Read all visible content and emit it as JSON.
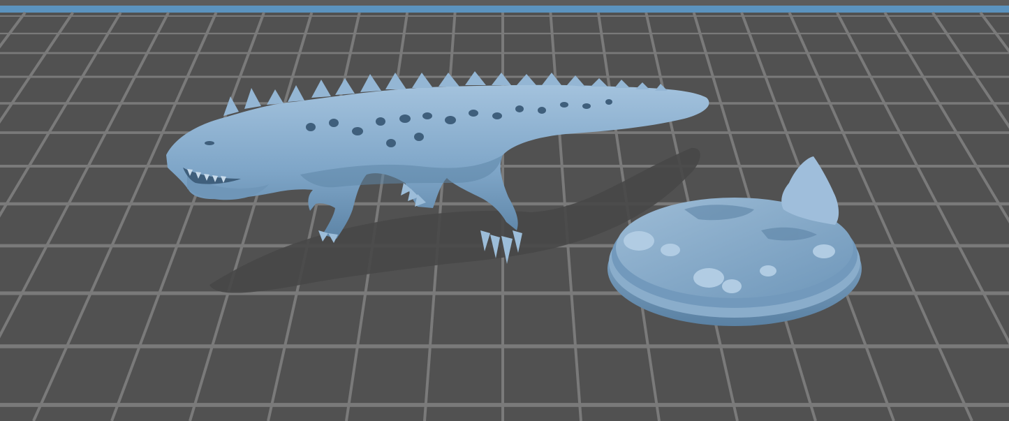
{
  "viewport": {
    "background_color": "#515151",
    "grid_color": "#7a7a7a",
    "accent_bar_color": "#5b93bf"
  },
  "scene": {
    "models": [
      {
        "name": "dinosaur-model",
        "color": "#7fa6c8"
      },
      {
        "name": "base-model",
        "color": "#7fa6c8"
      }
    ]
  }
}
